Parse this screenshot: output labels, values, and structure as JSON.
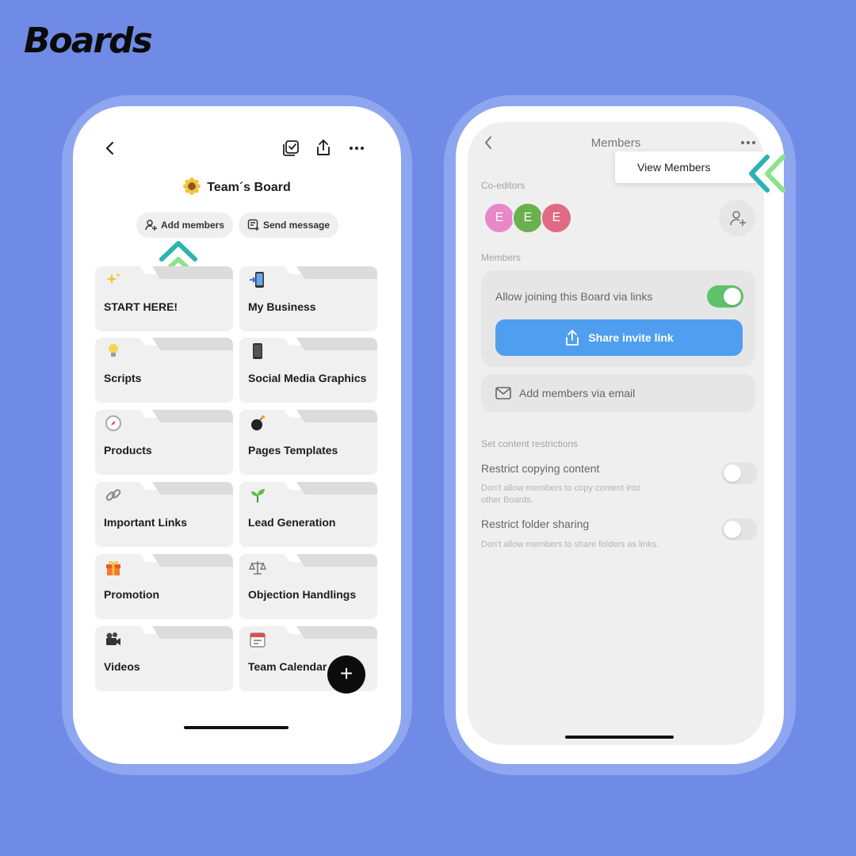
{
  "brand": {
    "title": "Boards"
  },
  "left": {
    "board_title": "Team´s Board",
    "actions": {
      "add_members": "Add members",
      "send_message": "Send message"
    },
    "cards": [
      {
        "label": "START HERE!",
        "icon": "sparkles-icon"
      },
      {
        "label": "My Business",
        "icon": "mobile-phone-arrow-icon"
      },
      {
        "label": "Scripts",
        "icon": "lightbulb-icon"
      },
      {
        "label": "Social Media Graphics",
        "icon": "mobile-phone-icon"
      },
      {
        "label": "Products",
        "icon": "compass-icon"
      },
      {
        "label": "Pages Templates",
        "icon": "bomb-icon"
      },
      {
        "label": "Important Links",
        "icon": "link-icon"
      },
      {
        "label": "Lead Generation",
        "icon": "seedling-icon"
      },
      {
        "label": "Promotion",
        "icon": "gift-icon"
      },
      {
        "label": "Objection Handlings",
        "icon": "balance-scale-icon"
      },
      {
        "label": "Videos",
        "icon": "movie-camera-icon"
      },
      {
        "label": "Team Calendar",
        "icon": "calendar-icon"
      }
    ],
    "fab_label": "+"
  },
  "right": {
    "title": "Members",
    "popup_item": "View Members",
    "coeditors_label": "Co-editors",
    "avatars": [
      {
        "initial": "E",
        "color": "#e888c8"
      },
      {
        "initial": "E",
        "color": "#6ab04c"
      },
      {
        "initial": "E",
        "color": "#e06a84"
      }
    ],
    "members_label": "Members",
    "allow_joining": {
      "label": "Allow joining this Board via links",
      "enabled": true
    },
    "share_invite": "Share invite link",
    "add_via_email": "Add members via email",
    "restrictions_label": "Set content restrictions",
    "restrict_copying": {
      "title": "Restrict copying content",
      "desc_line1": "Don't allow members to copy content into",
      "desc_line2": "other Boards.",
      "enabled": false
    },
    "restrict_sharing": {
      "title": "Restrict folder sharing",
      "desc": "Don't allow members to share folders as links.",
      "enabled": false
    }
  },
  "colors": {
    "background": "#6f8be6",
    "accent_blue": "#4f9ef0",
    "toggle_on": "#5fc26a",
    "arrow_teal": "#2bb3b1",
    "arrow_green": "#8be38b"
  }
}
